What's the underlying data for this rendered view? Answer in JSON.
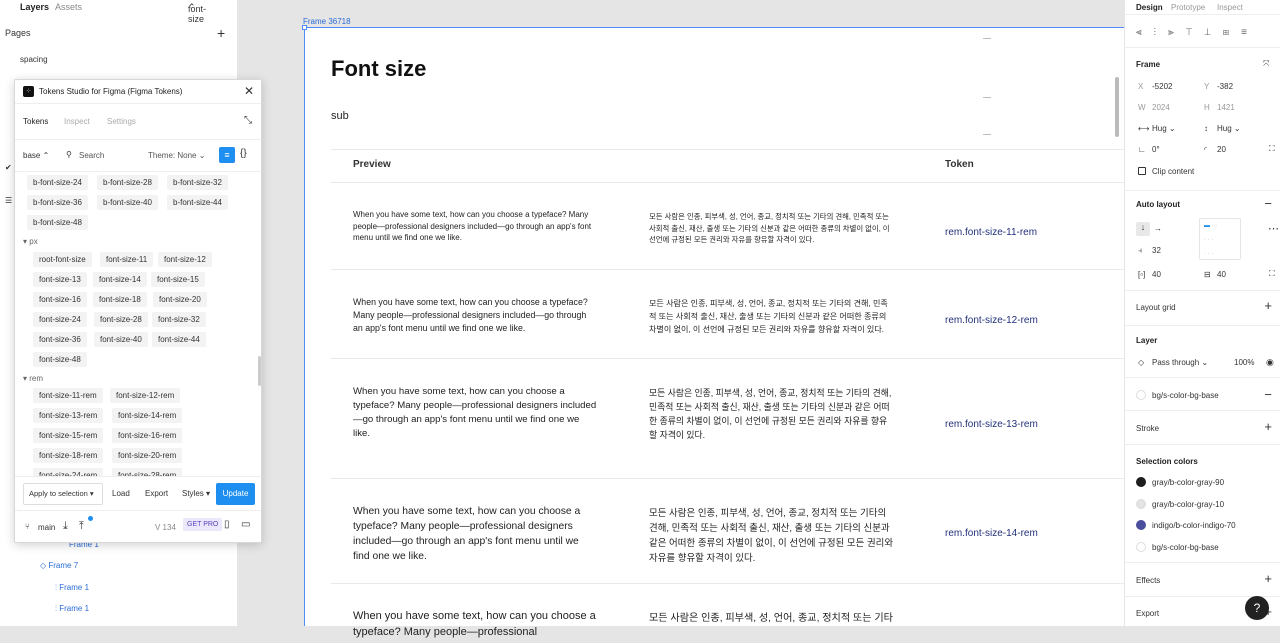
{
  "left_panel": {
    "tab_layers": "Layers",
    "tab_assets": "Assets",
    "page_selector": "font-size",
    "pages_label": "Pages",
    "page_item": "spacing",
    "layers": [
      "Frame 1",
      "Frame 7",
      "Frame 1",
      "Frame 1"
    ]
  },
  "plugin": {
    "title": "Tokens Studio for Figma (Figma Tokens)",
    "tabs": [
      "Tokens",
      "Inspect",
      "Settings"
    ],
    "set": "base",
    "search_placeholder": "Search",
    "theme": "Theme: None",
    "groups": [
      {
        "name": "",
        "chips": [
          "b-font-size-24",
          "b-font-size-28",
          "b-font-size-32",
          "b-font-size-36",
          "b-font-size-40",
          "b-font-size-44",
          "b-font-size-48"
        ]
      },
      {
        "name": "px",
        "chips": [
          "root-font-size",
          "font-size-11",
          "font-size-12",
          "font-size-13",
          "font-size-14",
          "font-size-15",
          "font-size-16",
          "font-size-18",
          "font-size-20",
          "font-size-24",
          "font-size-28",
          "font-size-32",
          "font-size-36",
          "font-size-40",
          "font-size-44",
          "font-size-48"
        ]
      },
      {
        "name": "rem",
        "chips": [
          "font-size-11-rem",
          "font-size-12-rem",
          "font-size-13-rem",
          "font-size-14-rem",
          "font-size-15-rem",
          "font-size-16-rem",
          "font-size-18-rem",
          "font-size-20-rem",
          "font-size-24-rem",
          "font-size-28-rem"
        ]
      }
    ],
    "footer": {
      "apply": "Apply to selection",
      "load": "Load",
      "export": "Export",
      "styles": "Styles",
      "update": "Update"
    },
    "branch": "main",
    "version": "V 134",
    "getpro": "GET PRO"
  },
  "canvas": {
    "frame_label": "Frame 36718",
    "title": "Font size",
    "subtitle": "sub",
    "headers": {
      "preview": "Preview",
      "token": "Token"
    },
    "rows": [
      {
        "en": "When you have some text, how can you choose a typeface? Many people—professional designers included—go through an app's font menu until we find one we like.",
        "ko": "모든 사람은 인종, 피부색, 성, 언어, 종교, 정치적 또는 기타의 견해, 민족적 또는 사회적 출신, 재산, 출생 또는 기타의 신분과 같은 어떠한 종류의 차별이 없이, 이 선언에 규정된 모든 권리와 자유를 향유할 자격이 있다.",
        "token": "rem.font-size-11-rem",
        "size": 8
      },
      {
        "en": "When you have some text, how can you choose a typeface? Many people—professional designers included—go through an app's font menu until we find one we like.",
        "ko": "모든 사람은 인종, 피부색, 성, 언어, 종교, 정치적 또는 기타의 견해, 민족적 또는 사회적 출신, 재산, 출생 또는 기타의 신분과 같은 어떠한 종류의 차별이 없이, 이 선언에 규정된 모든 권리와 자유를 향유할 자격이 있다.",
        "token": "rem.font-size-12-rem",
        "size": 8.8
      },
      {
        "en": "When you have some text, how can you choose a typeface? Many people—professional designers included—go through an app's font menu until we find one we like.",
        "ko": "모든 사람은 인종, 피부색, 성, 언어, 종교, 정치적 또는 기타의 견해, 민족적 또는 사회적 출신, 재산, 출생 또는 기타의 신분과 같은 어떠한 종류의 차별이 없이, 이 선언에 규정된 모든 권리와 자유를 향유할 자격이 있다.",
        "token": "rem.font-size-13-rem",
        "size": 9.6
      },
      {
        "en": "When you have some text, how can you choose a typeface? Many people—professional designers included—go through an app's font menu until we find one we like.",
        "ko": "모든 사람은 인종, 피부색, 성, 언어, 종교, 정치적 또는 기타의 견해, 민족적 또는 사회적 출신, 재산, 출생 또는 기타의 신분과 같은 어떠한 종류의 차별이 없이, 이 선언에 규정된 모든 권리와 자유를 향유할 자격이 있다.",
        "token": "rem.font-size-14-rem",
        "size": 10.3
      },
      {
        "en": "When you have some text, how can you choose a typeface? Many people—professional",
        "ko": "모든 사람은 인종, 피부색, 성, 언어, 종교, 정치적 또는 기타",
        "token": "",
        "size": 11
      }
    ]
  },
  "right_panel": {
    "tabs": [
      "Design",
      "Prototype",
      "Inspect"
    ],
    "frame_label": "Frame",
    "x": "-5202",
    "y": "-382",
    "w": "2024",
    "h": "1421",
    "hug_w": "Hug",
    "hug_h": "Hug",
    "rotation": "0°",
    "radius": "20",
    "clip": "Clip content",
    "auto_layout": "Auto layout",
    "gap": "32",
    "pad_h": "40",
    "pad_v": "40",
    "layout_grid": "Layout grid",
    "layer": "Layer",
    "blend": "Pass through",
    "opacity": "100%",
    "fill_style": "bg/s-color-bg-base",
    "stroke": "Stroke",
    "selection_colors": "Selection colors",
    "colors": [
      {
        "name": "gray/b-color-gray-90",
        "hex": "#1e1e1e"
      },
      {
        "name": "gray/b-color-gray-10",
        "hex": "#e3e3e6"
      },
      {
        "name": "indigo/b-color-indigo-70",
        "hex": "#4b4e9c"
      },
      {
        "name": "bg/s-color-bg-base",
        "hex": "#ffffff"
      }
    ],
    "effects": "Effects",
    "export": "Export",
    "help": "?"
  }
}
